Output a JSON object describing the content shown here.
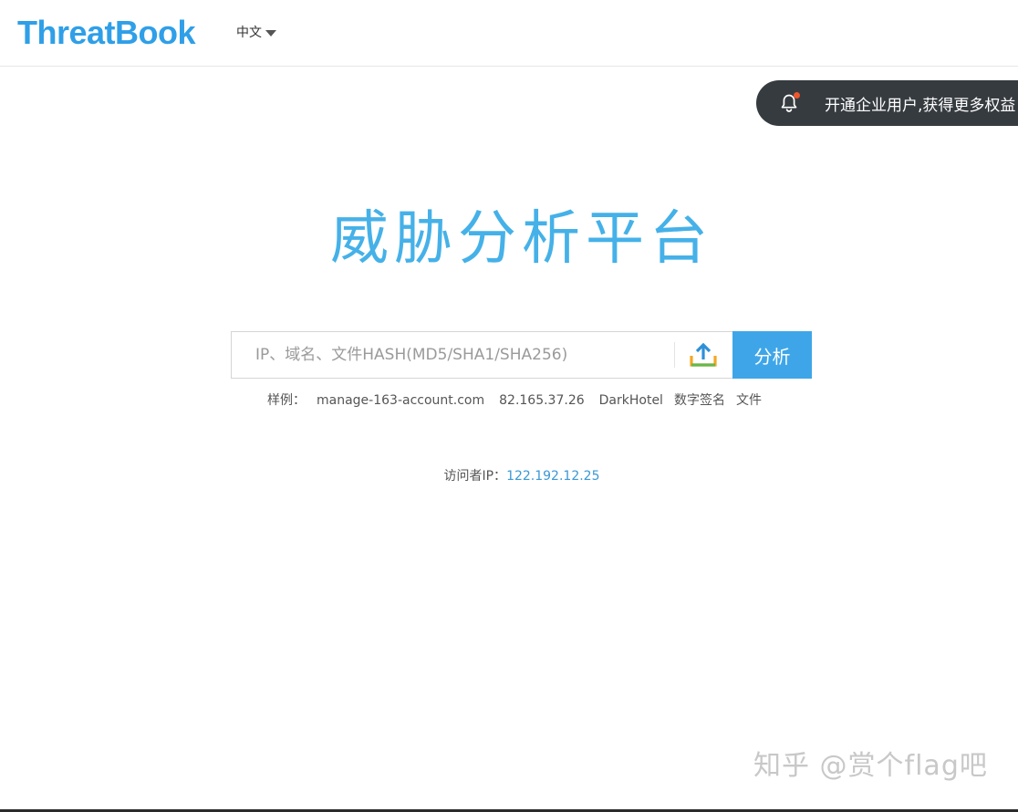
{
  "header": {
    "logo_text": "ThreatBook",
    "language_label": "中文"
  },
  "promo": {
    "text": "开通企业用户,获得更多权益",
    "icon": "bell-icon"
  },
  "hero": {
    "title": "威胁分析平台"
  },
  "search": {
    "placeholder": "IP、域名、文件HASH(MD5/SHA1/SHA256)",
    "value": "",
    "upload_icon": "upload-icon",
    "analyze_label": "分析"
  },
  "samples": {
    "label": "样例：",
    "items": [
      "manage-163-account.com",
      "82.165.37.26",
      "DarkHotel",
      "数字签名",
      "文件"
    ]
  },
  "visitor": {
    "label": "访问者IP：",
    "ip": "122.192.12.25"
  },
  "watermark": {
    "text": "知乎 @赏个flag吧"
  },
  "colors": {
    "brand": "#2f9fe8",
    "title": "#45b1e8",
    "button": "#3ea6e8",
    "promo_bg": "#363b40",
    "dot": "#f0562e"
  }
}
